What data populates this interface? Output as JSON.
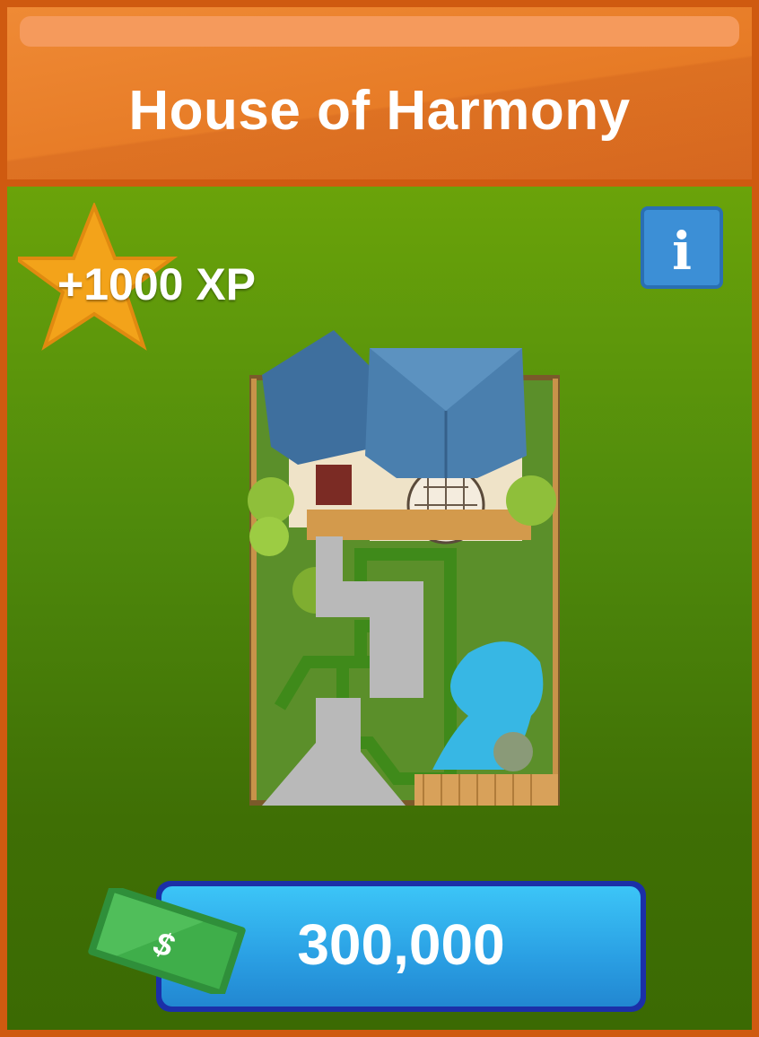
{
  "header": {
    "title": "House of Harmony"
  },
  "reward": {
    "xp_label": "+1000 XP",
    "star_icon": "star-icon"
  },
  "info": {
    "label": "i"
  },
  "item": {
    "image_icon": "japanese-house-garden-icon"
  },
  "purchase": {
    "price": "300,000",
    "currency_symbol": "$",
    "currency_icon": "dollar-bill-icon"
  },
  "colors": {
    "header": "#e67a25",
    "border": "#cf5a10",
    "body_top": "#6aa30a",
    "body_bottom": "#3b6a03",
    "button": "#2a9fe3",
    "info": "#3c8fd6",
    "star": "#f3a31a"
  }
}
